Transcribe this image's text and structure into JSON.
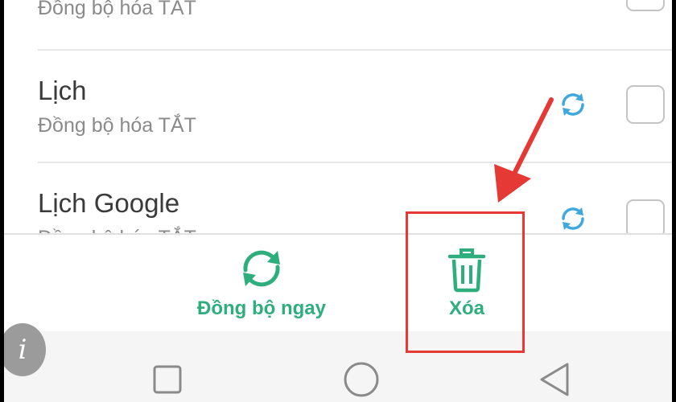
{
  "accounts": [
    {
      "title": "",
      "status": "Đồng bộ hóa TẮT"
    },
    {
      "title": "Lịch",
      "status": "Đồng bộ hóa TẮT"
    },
    {
      "title": "Lịch Google",
      "status": "Đồng bộ hóa TẮT"
    }
  ],
  "toolbar": {
    "sync_now_label": "Đồng bộ ngay",
    "delete_label": "Xóa"
  },
  "info_button": {
    "glyph": "i"
  },
  "colors": {
    "accent": "#2fae7d",
    "sync_icon": "#3fa8dc",
    "annotation": "#e53935"
  },
  "icons": {
    "sync": "sync-icon",
    "delete": "trash-icon",
    "nav_recent": "square-icon",
    "nav_home": "circle-icon",
    "nav_back": "triangle-back-icon"
  }
}
